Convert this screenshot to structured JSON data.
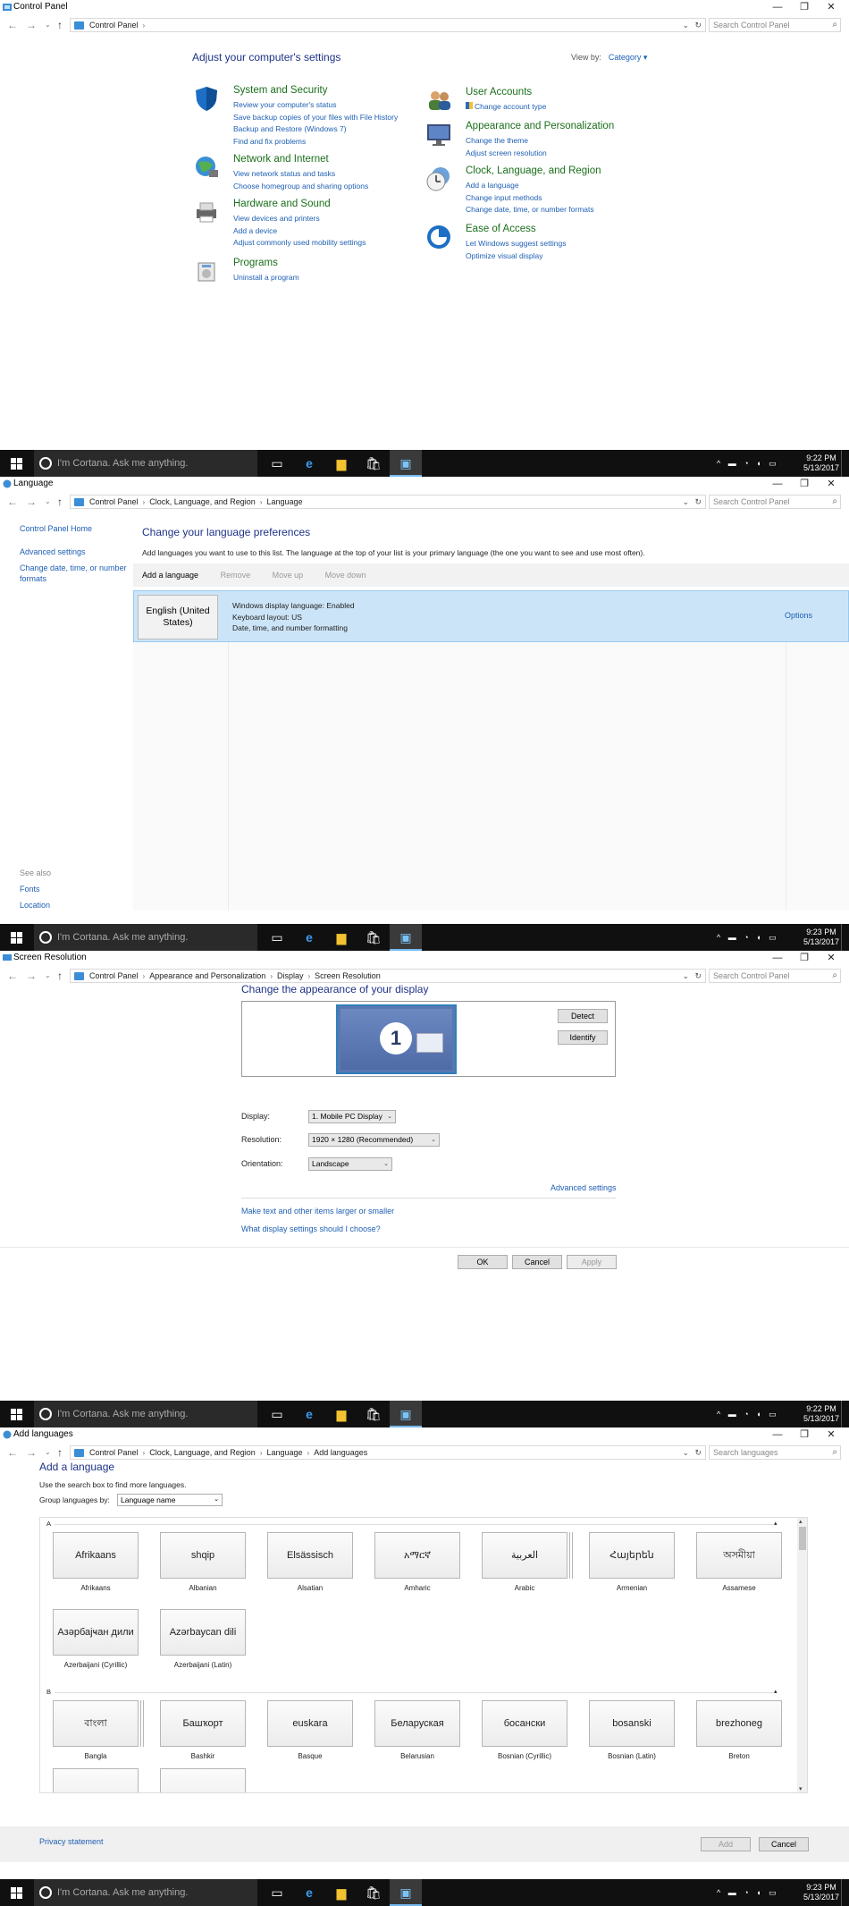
{
  "taskbar": {
    "cortana_placeholder": "I'm Cortana. Ask me anything.",
    "clock": [
      {
        "time": "9:22 PM",
        "date": "5/13/2017"
      },
      {
        "time": "9:23 PM",
        "date": "5/13/2017"
      },
      {
        "time": "9:22 PM",
        "date": "5/13/2017"
      },
      {
        "time": "9:23 PM",
        "date": "5/13/2017"
      }
    ],
    "apps": [
      "task-view",
      "edge",
      "file-explorer",
      "store",
      "control-panel"
    ]
  },
  "window_controls": {
    "min": "—",
    "max": "❐",
    "close": "✕"
  },
  "control_panel": {
    "title": "Control Panel",
    "breadcrumb": [
      "Control Panel"
    ],
    "search_placeholder": "Search Control Panel",
    "heading": "Adjust your computer's settings",
    "view_by_label": "View by:",
    "view_by_value": "Category ▾",
    "categories_left": [
      {
        "title": "System and Security",
        "icon": "shield-icon",
        "links": [
          "Review your computer's status",
          "Save backup copies of your files with File History",
          "Backup and Restore (Windows 7)",
          "Find and fix problems"
        ]
      },
      {
        "title": "Network and Internet",
        "icon": "network-globe-icon",
        "links": [
          "View network status and tasks",
          "Choose homegroup and sharing options"
        ]
      },
      {
        "title": "Hardware and Sound",
        "icon": "printer-icon",
        "links": [
          "View devices and printers",
          "Add a device",
          "Adjust commonly used mobility settings"
        ]
      },
      {
        "title": "Programs",
        "icon": "programs-icon",
        "links": [
          "Uninstall a program"
        ]
      }
    ],
    "categories_right": [
      {
        "title": "User Accounts",
        "icon": "users-icon",
        "links": [
          "Change account type"
        ]
      },
      {
        "title": "Appearance and Personalization",
        "icon": "display-icon",
        "links": [
          "Change the theme",
          "Adjust screen resolution"
        ]
      },
      {
        "title": "Clock, Language, and Region",
        "icon": "clock-globe-icon",
        "links": [
          "Add a language",
          "Change input methods",
          "Change date, time, or number formats"
        ]
      },
      {
        "title": "Ease of Access",
        "icon": "ease-of-access-icon",
        "links": [
          "Let Windows suggest settings",
          "Optimize visual display"
        ]
      }
    ]
  },
  "language": {
    "title": "Language",
    "breadcrumb": [
      "Control Panel",
      "Clock, Language, and Region",
      "Language"
    ],
    "search_placeholder": "Search Control Panel",
    "sidebar": [
      "Control Panel Home",
      "Advanced settings",
      "Change date, time, or number",
      "formats"
    ],
    "see_also_label": "See also",
    "see_also": [
      "Fonts",
      "Location"
    ],
    "heading": "Change your language preferences",
    "description": "Add languages you want to use to this list. The language at the top of your list is your primary language (the one you want to see and use most often).",
    "toolbar": [
      "Add a language",
      "Remove",
      "Move up",
      "Move down"
    ],
    "item": {
      "name_line1": "English (United",
      "name_line2": "States)",
      "info": [
        "Windows display language: Enabled",
        "Keyboard layout: US",
        "Date, time, and number formatting"
      ],
      "options": "Options"
    }
  },
  "screen_resolution": {
    "title": "Screen Resolution",
    "breadcrumb": [
      "Control Panel",
      "Appearance and Personalization",
      "Display",
      "Screen Resolution"
    ],
    "search_placeholder": "Search Control Panel",
    "heading": "Change the appearance of your display",
    "monitor_number": "1",
    "detect": "Detect",
    "identify": "Identify",
    "display_label": "Display:",
    "display_value": "1. Mobile PC Display",
    "resolution_label": "Resolution:",
    "resolution_value": "1920 × 1280 (Recommended)",
    "orientation_label": "Orientation:",
    "orientation_value": "Landscape",
    "advanced_settings": "Advanced settings",
    "link1": "Make text and other items larger or smaller",
    "link2": "What display settings should I choose?",
    "ok": "OK",
    "cancel": "Cancel",
    "apply": "Apply"
  },
  "add_languages": {
    "title": "Add languages",
    "breadcrumb": [
      "Control Panel",
      "Clock, Language, and Region",
      "Language",
      "Add languages"
    ],
    "search_placeholder": "Search languages",
    "heading": "Add a language",
    "description": "Use the search box to find more languages.",
    "group_label": "Group languages by:",
    "group_value": "Language name",
    "sections": [
      {
        "letter": "A",
        "tiles": [
          {
            "native": "Afrikaans",
            "name": "Afrikaans",
            "stack": false
          },
          {
            "native": "shqip",
            "name": "Albanian",
            "stack": false
          },
          {
            "native": "Elsässisch",
            "name": "Alsatian",
            "stack": false
          },
          {
            "native": "አማርኛ",
            "name": "Amharic",
            "stack": false
          },
          {
            "native": "العربية",
            "name": "Arabic",
            "stack": true
          },
          {
            "native": "Հայերեն",
            "name": "Armenian",
            "stack": false
          },
          {
            "native": "অসমীয়া",
            "name": "Assamese",
            "stack": false
          },
          {
            "native": "Азәрбајҹан дили",
            "name": "Azerbaijani (Cyrillic)",
            "stack": false
          },
          {
            "native": "Azərbaycan dili",
            "name": "Azerbaijani (Latin)",
            "stack": false
          }
        ]
      },
      {
        "letter": "B",
        "tiles": [
          {
            "native": "বাংলা",
            "name": "Bangla",
            "stack": true
          },
          {
            "native": "Башҡорт",
            "name": "Bashkir",
            "stack": false
          },
          {
            "native": "euskara",
            "name": "Basque",
            "stack": false
          },
          {
            "native": "Беларуская",
            "name": "Belarusian",
            "stack": false
          },
          {
            "native": "босански",
            "name": "Bosnian (Cyrillic)",
            "stack": false
          },
          {
            "native": "bosanski",
            "name": "Bosnian (Latin)",
            "stack": false
          },
          {
            "native": "brezhoneg",
            "name": "Breton",
            "stack": false
          }
        ]
      }
    ],
    "privacy": "Privacy statement",
    "add": "Add",
    "cancel": "Cancel"
  }
}
